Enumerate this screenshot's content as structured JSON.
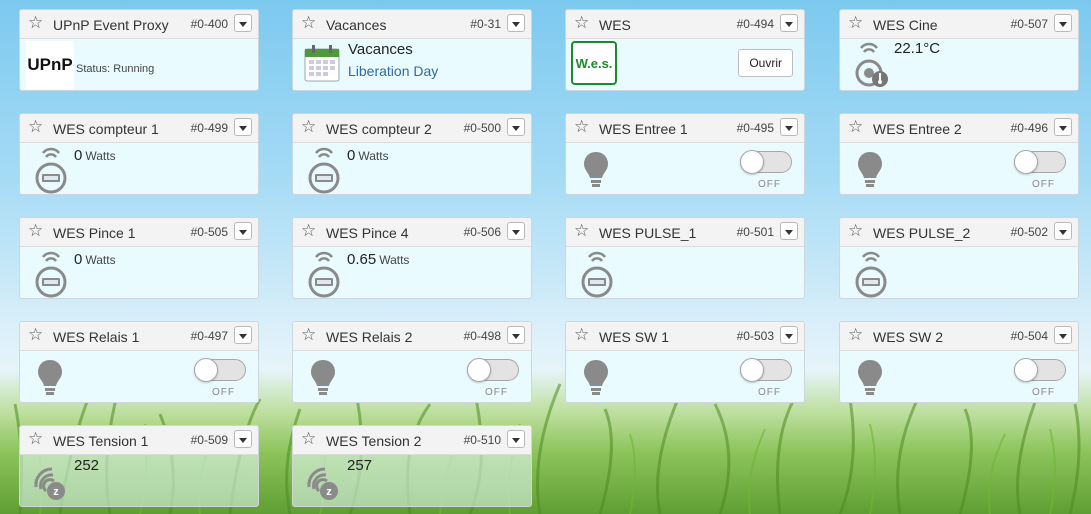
{
  "tiles": [
    {
      "name": "UPnP Event Proxy",
      "id": "#0-400",
      "kind": "upnp",
      "status": "Status: Running",
      "logo": "UPnP"
    },
    {
      "name": "Vacances",
      "id": "#0-31",
      "kind": "calendar",
      "title": "Vacances",
      "subtitle": "Liberation Day"
    },
    {
      "name": "WES",
      "id": "#0-494",
      "kind": "wes",
      "logo": "W.e.s.",
      "button": "Ouvrir"
    },
    {
      "name": "WES Cine",
      "id": "#0-507",
      "kind": "temp",
      "value": "22.1°C"
    },
    {
      "name": "WES compteur 1",
      "id": "#0-499",
      "kind": "meter",
      "value": "0",
      "unit": "Watts"
    },
    {
      "name": "WES compteur 2",
      "id": "#0-500",
      "kind": "meter",
      "value": "0",
      "unit": "Watts"
    },
    {
      "name": "WES Entree 1",
      "id": "#0-495",
      "kind": "switch",
      "state": "OFF"
    },
    {
      "name": "WES Entree 2",
      "id": "#0-496",
      "kind": "switch",
      "state": "OFF"
    },
    {
      "name": "WES Pince 1",
      "id": "#0-505",
      "kind": "meter",
      "value": "0",
      "unit": "Watts"
    },
    {
      "name": "WES Pince 4",
      "id": "#0-506",
      "kind": "meter",
      "value": "0.65",
      "unit": "Watts"
    },
    {
      "name": "WES PULSE_1",
      "id": "#0-501",
      "kind": "meter",
      "value": "",
      "unit": ""
    },
    {
      "name": "WES PULSE_2",
      "id": "#0-502",
      "kind": "meter",
      "value": "",
      "unit": ""
    },
    {
      "name": "WES Relais 1",
      "id": "#0-497",
      "kind": "switch",
      "state": "OFF"
    },
    {
      "name": "WES Relais 2",
      "id": "#0-498",
      "kind": "switch",
      "state": "OFF"
    },
    {
      "name": "WES SW 1",
      "id": "#0-503",
      "kind": "switch",
      "state": "OFF"
    },
    {
      "name": "WES SW 2",
      "id": "#0-504",
      "kind": "switch",
      "state": "OFF"
    },
    {
      "name": "WES Tension 1",
      "id": "#0-509",
      "kind": "zwave",
      "value": "252"
    },
    {
      "name": "WES Tension 2",
      "id": "#0-510",
      "kind": "zwave",
      "value": "257"
    }
  ],
  "icons": {
    "star": "star-icon",
    "menu": "chevron-down-icon",
    "bulb": "lightbulb-icon",
    "meter": "power-meter-icon",
    "temp": "thermometer-icon",
    "zwave": "zwave-sensor-icon",
    "calendar": "calendar-icon"
  },
  "colors": {
    "tile_bg": "#e9fbff",
    "header_bg": "#f3f3f3",
    "wes_green": "#1b8a2a",
    "link_blue": "#2e6b9e"
  }
}
